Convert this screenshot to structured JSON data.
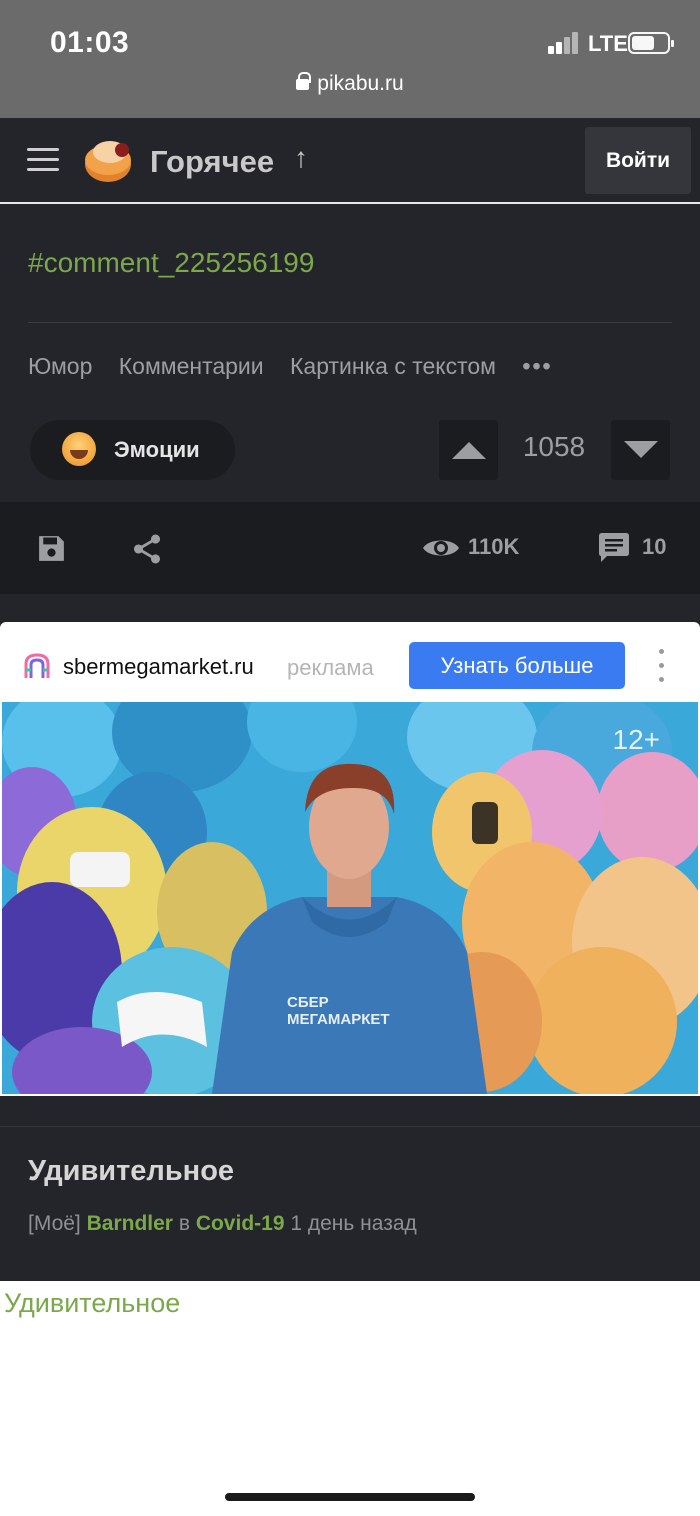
{
  "status_bar": {
    "time": "01:03",
    "network": "LTE",
    "url": "pikabu.ru"
  },
  "header": {
    "title": "Горячее",
    "arrow": "↑",
    "login_label": "Войти"
  },
  "post": {
    "hashtag": "#comment_225256199",
    "tags": [
      "Юмор",
      "Комментарии",
      "Картинка с текстом"
    ],
    "more_tags": "•••",
    "emotion_label": "Эмоции",
    "rating": "1058",
    "views": "110K",
    "comments_count": "10"
  },
  "ad": {
    "domain": "sbermegamarket.ru",
    "label": "реклама",
    "cta": "Узнать больше",
    "age_rating": "12+",
    "image_text": "СБЕР МЕГАМАРКЕТ",
    "image_text_line1": "СБЕР",
    "image_text_line2": "МЕГАМАРКЕТ"
  },
  "next_post": {
    "title": "Удивительное",
    "prefix": "[Моё]",
    "author": "Barndler",
    "in_word": "в",
    "community": "Covid-19",
    "time": "1 день назад",
    "body_title": "Удивительное"
  },
  "colors": {
    "accent_green": "#7aa84a",
    "cta_blue": "#3b7bf2",
    "background": "#23252a"
  },
  "icons": [
    "lock-icon",
    "menu-icon",
    "pikabu-logo",
    "save-icon",
    "share-icon",
    "eye-icon",
    "comment-icon",
    "kebab-icon"
  ]
}
